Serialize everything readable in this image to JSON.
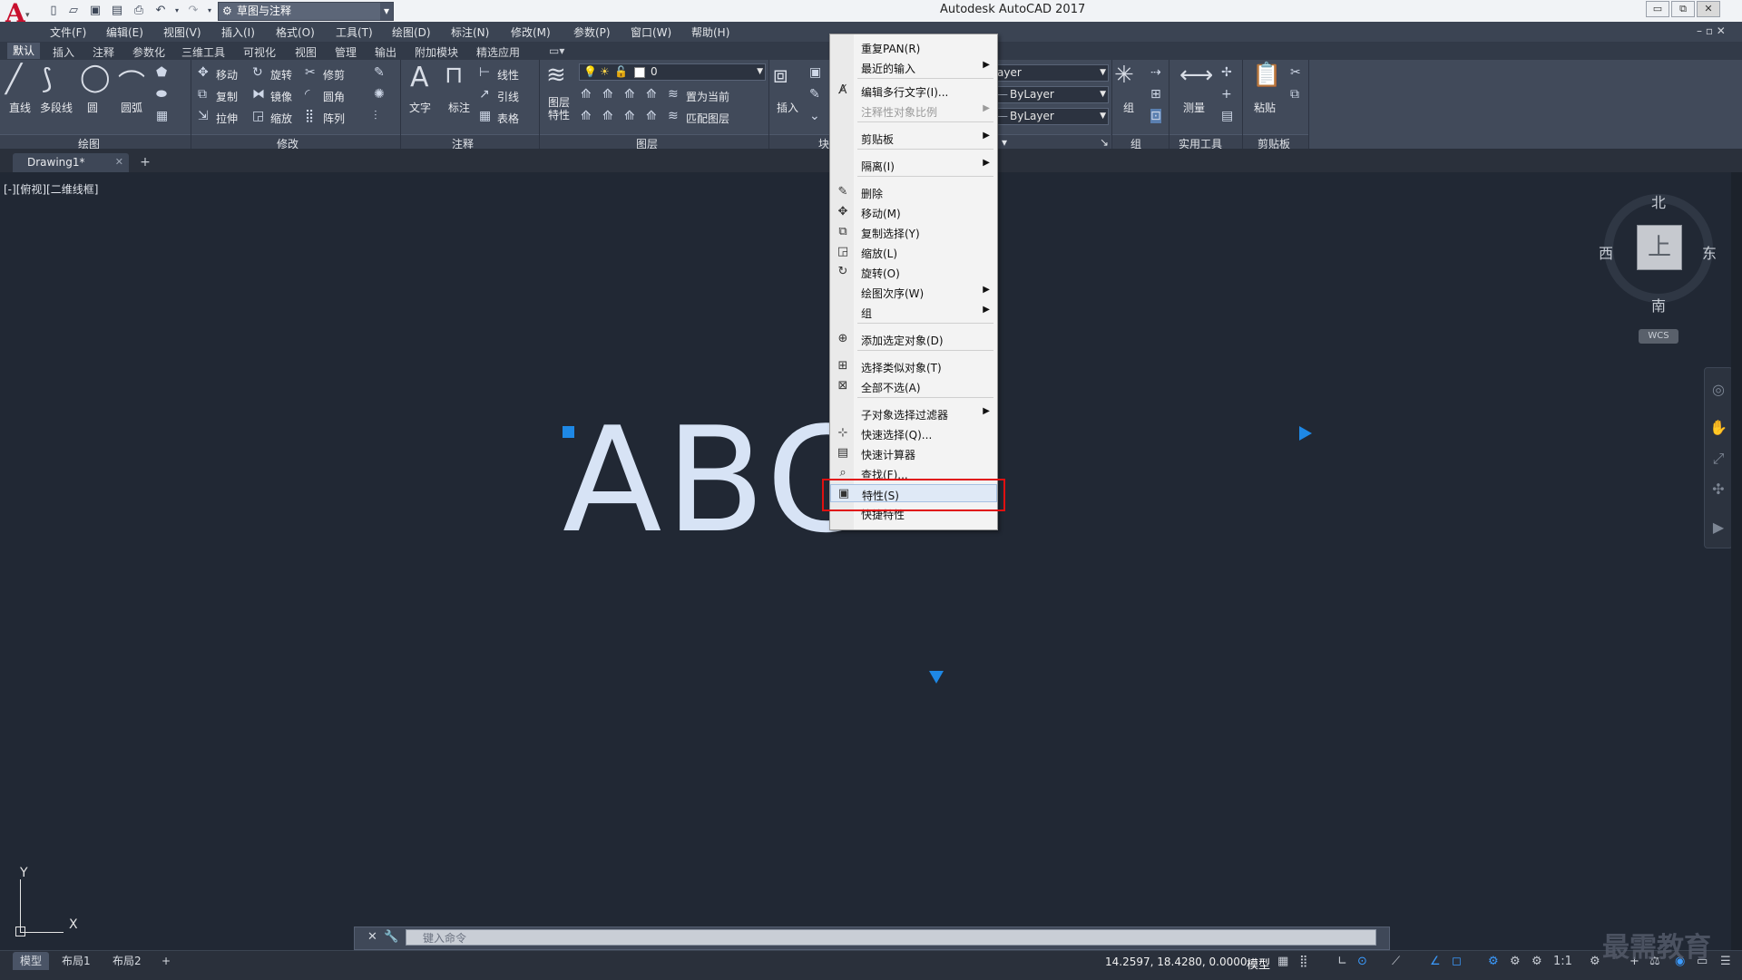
{
  "titlebar": {
    "app_title": "Autodesk AutoCAD 2017",
    "workspace": "草图与注释",
    "logo": "A"
  },
  "menubar": [
    "文件(F)",
    "编辑(E)",
    "视图(V)",
    "插入(I)",
    "格式(O)",
    "工具(T)",
    "绘图(D)",
    "标注(N)",
    "修改(M)",
    "参数(P)",
    "窗口(W)",
    "帮助(H)"
  ],
  "ribbon_tabs": [
    "默认",
    "插入",
    "注释",
    "参数化",
    "三维工具",
    "可视化",
    "视图",
    "管理",
    "输出",
    "附加模块",
    "精选应用"
  ],
  "ribbon": {
    "draw": {
      "line": "直线",
      "polyline": "多段线",
      "circle": "圆",
      "arc": "圆弧",
      "panel": "绘图"
    },
    "modify": {
      "move": "移动",
      "rotate": "旋转",
      "trim": "修剪",
      "copy": "复制",
      "mirror": "镜像",
      "fillet": "圆角",
      "stretch": "拉伸",
      "scale": "缩放",
      "array": "阵列",
      "panel": "修改"
    },
    "annotation": {
      "text": "文字",
      "dimension": "标注",
      "linear": "线性",
      "leader": "引线",
      "table": "表格",
      "panel": "注释"
    },
    "layers": {
      "properties": "图层特性",
      "layer_value": "0",
      "set_current": "置为当前",
      "match_layer": "匹配图层",
      "panel": "图层"
    },
    "block": {
      "insert": "插入",
      "panel": "块"
    },
    "properties": {
      "color": "ayer",
      "linetype": "ByLayer",
      "lineweight": "ByLayer"
    },
    "groups": {
      "group": "组",
      "panel": "组"
    },
    "utilities": {
      "measure": "测量",
      "panel": "实用工具"
    },
    "clipboard": {
      "paste": "粘贴",
      "panel": "剪贴板"
    }
  },
  "file_tabs": {
    "active": "Drawing1*"
  },
  "viewport_label": "[-][俯视][二维线框]",
  "canvas_text": "ABCD",
  "viewcube": {
    "north": "北",
    "south": "南",
    "west": "西",
    "east": "东",
    "face": "上",
    "wcs": "WCS"
  },
  "ucs": {
    "x": "X",
    "y": "Y"
  },
  "command_line": {
    "placeholder": "键入命令"
  },
  "statusbar": {
    "layout_tabs": [
      "模型",
      "布局1",
      "布局2"
    ],
    "coords": "14.2597, 18.4280, 0.0000",
    "model": "模型",
    "scale": "1:1"
  },
  "watermark": "最需教育",
  "context_menu": {
    "items": [
      {
        "label": "重复PAN(R)",
        "submenu": false,
        "disabled": false
      },
      {
        "label": "最近的输入",
        "submenu": true,
        "disabled": false
      },
      {
        "label": "编辑多行文字(I)...",
        "submenu": false,
        "disabled": false
      },
      {
        "label": "注释性对象比例",
        "submenu": true,
        "disabled": true
      },
      {
        "label": "剪贴板",
        "submenu": true,
        "disabled": false
      },
      {
        "label": "隔离(I)",
        "submenu": true,
        "disabled": false
      },
      {
        "label": "删除",
        "submenu": false,
        "disabled": false
      },
      {
        "label": "移动(M)",
        "submenu": false,
        "disabled": false
      },
      {
        "label": "复制选择(Y)",
        "submenu": false,
        "disabled": false
      },
      {
        "label": "缩放(L)",
        "submenu": false,
        "disabled": false
      },
      {
        "label": "旋转(O)",
        "submenu": false,
        "disabled": false
      },
      {
        "label": "绘图次序(W)",
        "submenu": true,
        "disabled": false
      },
      {
        "label": "组",
        "submenu": true,
        "disabled": false
      },
      {
        "label": "添加选定对象(D)",
        "submenu": false,
        "disabled": false
      },
      {
        "label": "选择类似对象(T)",
        "submenu": false,
        "disabled": false
      },
      {
        "label": "全部不选(A)",
        "submenu": false,
        "disabled": false
      },
      {
        "label": "子对象选择过滤器",
        "submenu": true,
        "disabled": false
      },
      {
        "label": "快速选择(Q)...",
        "submenu": false,
        "disabled": false
      },
      {
        "label": "快速计算器",
        "submenu": false,
        "disabled": false
      },
      {
        "label": "查找(F)...",
        "submenu": false,
        "disabled": false
      },
      {
        "label": "特性(S)",
        "submenu": false,
        "disabled": false,
        "highlighted": true
      },
      {
        "label": "快捷特性",
        "submenu": false,
        "disabled": false
      }
    ]
  },
  "colors": {
    "canvas": "#212834",
    "highlight": "#e01010",
    "grip": "#1e88e5"
  }
}
